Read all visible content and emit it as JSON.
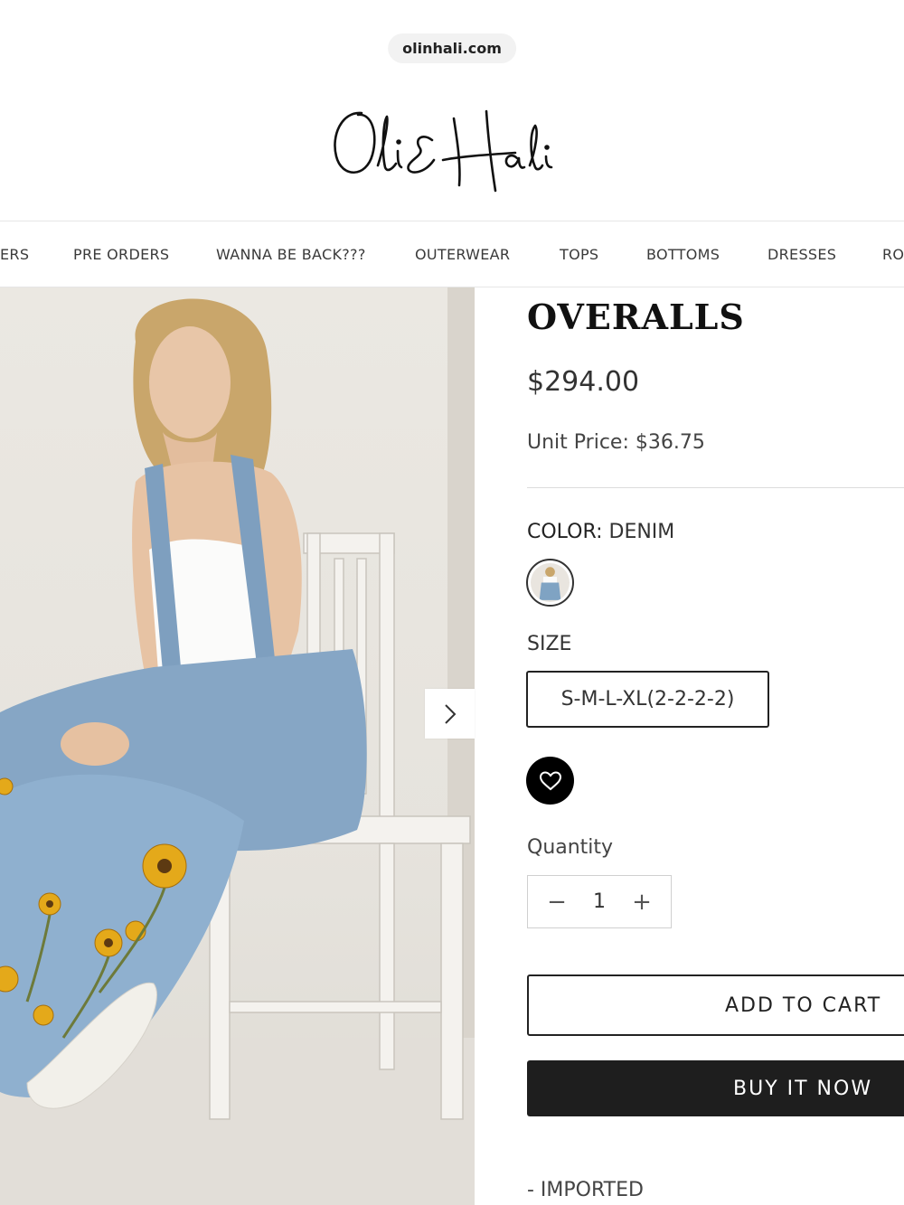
{
  "browser": {
    "url": "olinhali.com"
  },
  "brand": {
    "logo_text": "Oli & Hali"
  },
  "nav": {
    "items": [
      "ERS",
      "PRE ORDERS",
      "WANNA BE BACK???",
      "OUTERWEAR",
      "TOPS",
      "BOTTOMS",
      "DRESSES",
      "RO"
    ]
  },
  "product": {
    "title": "OVERALLS",
    "price": "$294.00",
    "unit_price": "Unit Price: $36.75",
    "color_label": "COLOR:",
    "color_value": "DENIM",
    "size_label": "SIZE",
    "size_value": "S-M-L-XL(2-2-2-2)",
    "quantity_label": "Quantity",
    "quantity_value": "1",
    "qty_minus": "−",
    "qty_plus": "+",
    "add_to_cart": "ADD TO CART",
    "buy_now": "BUY IT NOW",
    "details": "- IMPORTED"
  },
  "gallery": {
    "next_icon": "chevron-right-icon"
  },
  "colors": {
    "accent_dark": "#1e1e1e",
    "denim": "#7fa3c3",
    "sunflower": "#e4a91a"
  }
}
